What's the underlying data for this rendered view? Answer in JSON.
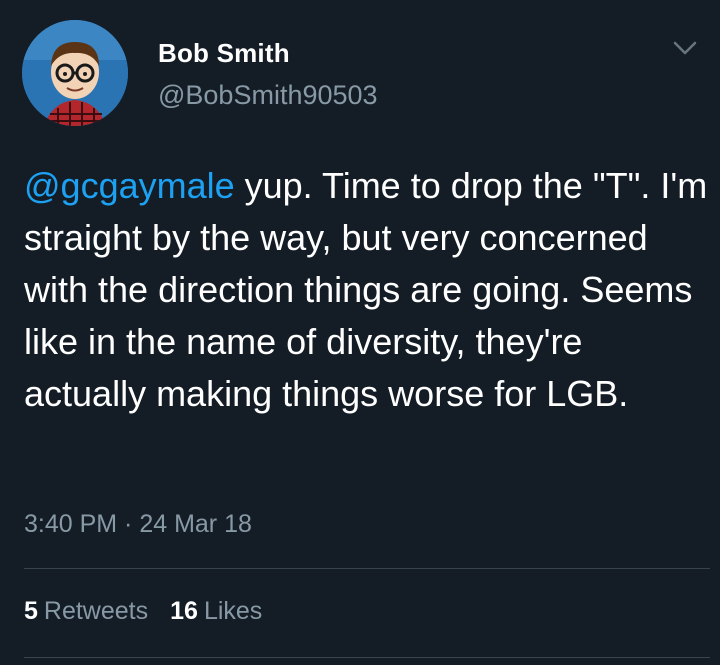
{
  "user": {
    "display_name": "Bob Smith",
    "handle": "@BobSmith90503",
    "avatar_icon": "cartoon-avatar-icon"
  },
  "tweet": {
    "mention": "@gcgaymale",
    "text": " yup. Time to drop the \"T\". I'm straight by the way, but very concerned with the direction things are going. Seems like in the name of diversity, they're actually making things worse for LGB.",
    "time": "3:40 PM",
    "separator": " · ",
    "date": "24 Mar 18"
  },
  "stats": {
    "retweets_count": "5",
    "retweets_label": "Retweets",
    "likes_count": "16",
    "likes_label": "Likes"
  },
  "colors": {
    "background": "#141d26",
    "link": "#1da1f2",
    "secondary_text": "#8899a6",
    "divider": "#38444d"
  }
}
